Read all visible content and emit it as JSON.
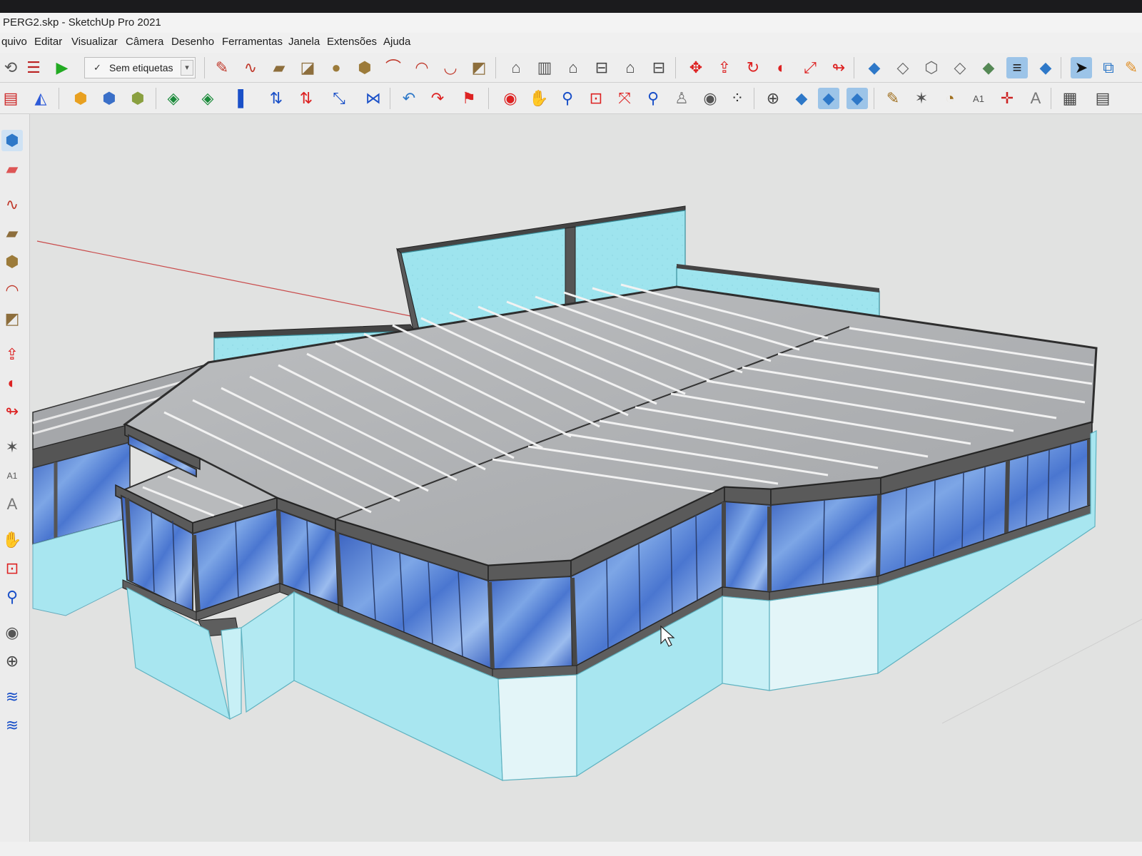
{
  "window": {
    "title": "PERG2.skp - SketchUp Pro 2021"
  },
  "menu": [
    "quivo",
    "Editar",
    "Visualizar",
    "Câmera",
    "Desenho",
    "Ferramentas",
    "Janela",
    "Extensões",
    "Ajuda"
  ],
  "tag_selector": {
    "value": "Sem etiquetas",
    "check": "✓"
  },
  "colors": {
    "glass": "#5b86d6",
    "parapet": "#a8e6f0",
    "frame": "#4a4a4a",
    "roof": "#a9abad"
  },
  "cursor": "arrow-cursor"
}
